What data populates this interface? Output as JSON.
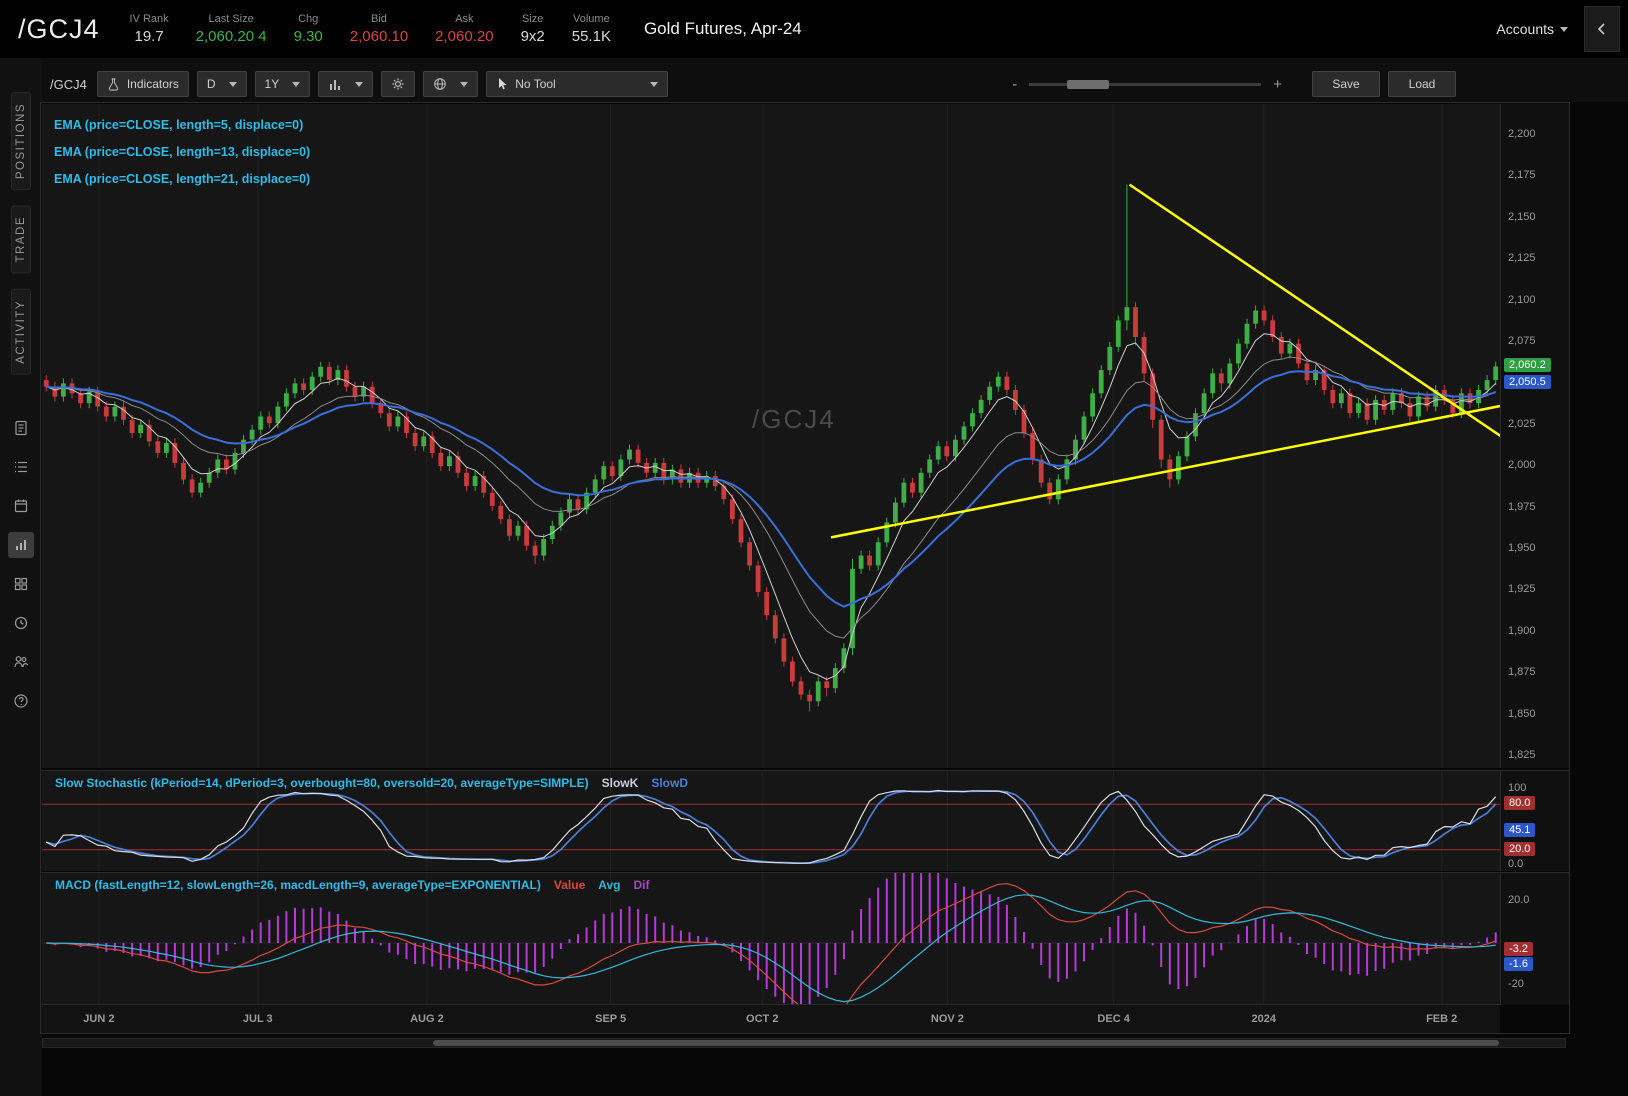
{
  "header": {
    "symbol": "/GCJ4",
    "title": "Gold Futures, Apr-24",
    "accounts_label": "Accounts",
    "stats": [
      {
        "label": "IV Rank",
        "value": "19.7",
        "color": "#d8d8d8"
      },
      {
        "label": "Last Size",
        "value": "2,060.20 4",
        "color": "#3cb54b"
      },
      {
        "label": "Chg",
        "value": "9.30",
        "color": "#3cb54b"
      },
      {
        "label": "Bid",
        "value": "2,060.10",
        "color": "#d64a3f"
      },
      {
        "label": "Ask",
        "value": "2,060.20",
        "color": "#d64a3f"
      },
      {
        "label": "Size",
        "value": "9x2",
        "color": "#d8d8d8"
      },
      {
        "label": "Volume",
        "value": "55.1K",
        "color": "#d8d8d8"
      }
    ]
  },
  "sidebar": {
    "tabs": [
      {
        "label": "POSITIONS"
      },
      {
        "label": "TRADE"
      },
      {
        "label": "ACTIVITY"
      }
    ]
  },
  "toolbar": {
    "symbol": "/GCJ4",
    "indicators_label": "Indicators",
    "timeframe": "D",
    "range": "1Y",
    "tool_label": "No Tool",
    "zoom_minus": "-",
    "zoom_plus": "+",
    "save_label": "Save",
    "load_label": "Load"
  },
  "chart": {
    "watermark": "/GCJ4",
    "ema_labels": [
      "EMA (price=CLOSE, length=5, displace=0)",
      "EMA (price=CLOSE, length=13, displace=0)",
      "EMA (price=CLOSE, length=21, displace=0)"
    ]
  },
  "stoch": {
    "title": "Slow Stochastic (kPeriod=14, dPeriod=3, overbought=80, oversold=20, averageType=SIMPLE)",
    "legend": [
      {
        "label": "SlowK",
        "color": "#c9ced8"
      },
      {
        "label": "SlowD",
        "color": "#4a7fd8"
      }
    ]
  },
  "macd": {
    "title": "MACD (fastLength=12, slowLength=26, macdLength=9, averageType=EXPONENTIAL)",
    "legend": [
      {
        "label": "Value",
        "color": "#d64a3f"
      },
      {
        "label": "Avg",
        "color": "#35b8d8"
      },
      {
        "label": "Dif",
        "color": "#b03fd0"
      }
    ]
  },
  "chart_data": {
    "type": "candlestick",
    "symbol": "/GCJ4",
    "title": "Gold Futures, Apr-24, Daily, 1 Year",
    "last_price": 2060.2,
    "colors": {
      "up": "#3fae49",
      "down": "#c83c3c",
      "ema5": "#cfcfcf",
      "ema13": "#8a8a8a",
      "ema21": "#3a6fd8",
      "trendline": "#ffff00",
      "grid": "#212121",
      "slowk": "#d8dee8",
      "slowd": "#4a7fd8",
      "ob_os_line": "#a03030",
      "macd_value": "#d64a3f",
      "macd_avg": "#35b8d8",
      "macd_hist": "#b43bd8"
    },
    "price_axis": {
      "ticks": [
        {
          "label": "2,200",
          "value": 2200
        },
        {
          "label": "2,175",
          "value": 2175
        },
        {
          "label": "2,150",
          "value": 2150
        },
        {
          "label": "2,125",
          "value": 2125
        },
        {
          "label": "2,100",
          "value": 2100
        },
        {
          "label": "2,075",
          "value": 2075
        },
        {
          "label": "2,050",
          "value": 2050
        },
        {
          "label": "2,025",
          "value": 2025
        },
        {
          "label": "2,000",
          "value": 2000
        },
        {
          "label": "1,975",
          "value": 1975
        },
        {
          "label": "1,950",
          "value": 1950
        },
        {
          "label": "1,925",
          "value": 1925
        },
        {
          "label": "1,900",
          "value": 1900
        },
        {
          "label": "1,875",
          "value": 1875
        },
        {
          "label": "1,850",
          "value": 1850
        },
        {
          "label": "1,825",
          "value": 1825
        }
      ],
      "badges": [
        {
          "label": "2,060.2",
          "value": 2060.2,
          "bg": "#2f9e44"
        },
        {
          "label": "2,050.5",
          "value": 2050.5,
          "bg": "#2b57c8"
        }
      ]
    },
    "stoch_axis": {
      "labels": [
        {
          "label": "100",
          "value": 100
        },
        {
          "label": "0.0",
          "value": 0
        }
      ],
      "badges": [
        {
          "label": "80.0",
          "value": 80,
          "bg": "#a03030"
        },
        {
          "label": "45.1",
          "value": 45.1,
          "bg": "#2b57c8"
        },
        {
          "label": "20.0",
          "value": 20,
          "bg": "#a03030"
        }
      ]
    },
    "macd_axis": {
      "labels": [
        {
          "label": "20.0",
          "value": 20
        },
        {
          "label": "-20",
          "value": -20
        }
      ],
      "badges": [
        {
          "label": "-3.2",
          "value": -3.2,
          "bg": "#a03030"
        },
        {
          "label": "-1.6",
          "value": -1.6,
          "bg": "#2b57c8"
        }
      ]
    },
    "time_axis": [
      {
        "label": "JUN 2",
        "frac": 0.039
      },
      {
        "label": "JUL 3",
        "frac": 0.148
      },
      {
        "label": "AUG 2",
        "frac": 0.264
      },
      {
        "label": "SEP 5",
        "frac": 0.39
      },
      {
        "label": "OCT 2",
        "frac": 0.494
      },
      {
        "label": "NOV 2",
        "frac": 0.621
      },
      {
        "label": "DEC 4",
        "frac": 0.735
      },
      {
        "label": "2024",
        "frac": 0.838
      },
      {
        "label": "FEB 2",
        "frac": 0.96
      }
    ],
    "trendlines": [
      {
        "i1": 126.3,
        "p1": 2170,
        "i2": 170.2,
        "p2": 2016
      },
      {
        "i1": 91.5,
        "p1": 1957,
        "i2": 170.2,
        "p2": 2037
      }
    ],
    "candles": [
      [
        2052,
        2055,
        2045,
        2048
      ],
      [
        2048,
        2051,
        2039,
        2042
      ],
      [
        2042,
        2053,
        2039,
        2050
      ],
      [
        2050,
        2053,
        2041,
        2044
      ],
      [
        2044,
        2047,
        2035,
        2038
      ],
      [
        2038,
        2048,
        2035,
        2045
      ],
      [
        2045,
        2048,
        2033,
        2036
      ],
      [
        2036,
        2039,
        2027,
        2030
      ],
      [
        2030,
        2039,
        2027,
        2036
      ],
      [
        2036,
        2039,
        2025,
        2028
      ],
      [
        2028,
        2031,
        2017,
        2020
      ],
      [
        2020,
        2028,
        2017,
        2025
      ],
      [
        2025,
        2028,
        2012,
        2015
      ],
      [
        2015,
        2018,
        2005,
        2008
      ],
      [
        2008,
        2017,
        2005,
        2014
      ],
      [
        2014,
        2017,
        1999,
        2002
      ],
      [
        2002,
        2005,
        1989,
        1992
      ],
      [
        1992,
        1995,
        1981,
        1984
      ],
      [
        1984,
        1993,
        1981,
        1990
      ],
      [
        1990,
        1999,
        1987,
        1996
      ],
      [
        1996,
        2007,
        1993,
        2004
      ],
      [
        2004,
        2007,
        1995,
        1998
      ],
      [
        1998,
        2011,
        1995,
        2008
      ],
      [
        2008,
        2019,
        2005,
        2016
      ],
      [
        2016,
        2025,
        2013,
        2022
      ],
      [
        2022,
        2033,
        2019,
        2030
      ],
      [
        2030,
        2033,
        2023,
        2026
      ],
      [
        2026,
        2039,
        2023,
        2036
      ],
      [
        2036,
        2047,
        2033,
        2044
      ],
      [
        2044,
        2053,
        2041,
        2050
      ],
      [
        2050,
        2053,
        2043,
        2046
      ],
      [
        2046,
        2057,
        2043,
        2054
      ],
      [
        2054,
        2063,
        2051,
        2060
      ],
      [
        2060,
        2063,
        2049,
        2052
      ],
      [
        2052,
        2061,
        2049,
        2058
      ],
      [
        2058,
        2061,
        2045,
        2048
      ],
      [
        2048,
        2051,
        2039,
        2042
      ],
      [
        2042,
        2051,
        2039,
        2048
      ],
      [
        2048,
        2051,
        2035,
        2038
      ],
      [
        2038,
        2041,
        2029,
        2032
      ],
      [
        2032,
        2035,
        2021,
        2024
      ],
      [
        2024,
        2033,
        2021,
        2030
      ],
      [
        2030,
        2033,
        2017,
        2020
      ],
      [
        2020,
        2023,
        2009,
        2012
      ],
      [
        2012,
        2021,
        2009,
        2018
      ],
      [
        2018,
        2021,
        2005,
        2008
      ],
      [
        2008,
        2011,
        1997,
        2000
      ],
      [
        2000,
        2009,
        1997,
        2006
      ],
      [
        2006,
        2009,
        1993,
        1996
      ],
      [
        1996,
        1999,
        1985,
        1988
      ],
      [
        1988,
        1997,
        1985,
        1994
      ],
      [
        1994,
        1997,
        1981,
        1984
      ],
      [
        1984,
        1987,
        1973,
        1976
      ],
      [
        1976,
        1979,
        1965,
        1968
      ],
      [
        1968,
        1971,
        1955,
        1958
      ],
      [
        1958,
        1967,
        1955,
        1964
      ],
      [
        1964,
        1967,
        1949,
        1952
      ],
      [
        1952,
        1955,
        1941,
        1946
      ],
      [
        1946,
        1959,
        1943,
        1956
      ],
      [
        1956,
        1967,
        1953,
        1964
      ],
      [
        1964,
        1975,
        1961,
        1972
      ],
      [
        1972,
        1983,
        1969,
        1980
      ],
      [
        1980,
        1983,
        1971,
        1974
      ],
      [
        1974,
        1987,
        1971,
        1984
      ],
      [
        1984,
        1995,
        1981,
        1992
      ],
      [
        1992,
        2003,
        1989,
        2000
      ],
      [
        2000,
        2003,
        1991,
        1994
      ],
      [
        1994,
        2007,
        1991,
        2004
      ],
      [
        2004,
        2013,
        2001,
        2010
      ],
      [
        2010,
        2013,
        1999,
        2002
      ],
      [
        2002,
        2005,
        1993,
        1996
      ],
      [
        1996,
        2005,
        1993,
        2002
      ],
      [
        2002,
        2005,
        1989,
        1992
      ],
      [
        1992,
        2001,
        1989,
        1998
      ],
      [
        1998,
        2001,
        1987,
        1990
      ],
      [
        1990,
        1999,
        1987,
        1996
      ],
      [
        1996,
        1999,
        1987,
        1990
      ],
      [
        1990,
        1997,
        1987,
        1994
      ],
      [
        1994,
        1997,
        1985,
        1988
      ],
      [
        1988,
        1991,
        1977,
        1980
      ],
      [
        1980,
        1983,
        1965,
        1968
      ],
      [
        1968,
        1971,
        1951,
        1954
      ],
      [
        1954,
        1957,
        1937,
        1940
      ],
      [
        1940,
        1943,
        1921,
        1924
      ],
      [
        1924,
        1927,
        1907,
        1910
      ],
      [
        1910,
        1913,
        1893,
        1896
      ],
      [
        1896,
        1899,
        1879,
        1882
      ],
      [
        1882,
        1885,
        1867,
        1870
      ],
      [
        1870,
        1873,
        1859,
        1862
      ],
      [
        1862,
        1865,
        1852,
        1858
      ],
      [
        1858,
        1873,
        1855,
        1870
      ],
      [
        1870,
        1873,
        1861,
        1866
      ],
      [
        1866,
        1881,
        1863,
        1878
      ],
      [
        1878,
        1893,
        1875,
        1890
      ],
      [
        1890,
        1944,
        1886,
        1938
      ],
      [
        1938,
        1949,
        1935,
        1946
      ],
      [
        1946,
        1949,
        1937,
        1940
      ],
      [
        1940,
        1957,
        1937,
        1954
      ],
      [
        1954,
        1969,
        1951,
        1966
      ],
      [
        1966,
        1981,
        1963,
        1978
      ],
      [
        1978,
        1993,
        1975,
        1990
      ],
      [
        1990,
        1993,
        1981,
        1984
      ],
      [
        1984,
        1999,
        1981,
        1996
      ],
      [
        1996,
        2007,
        1993,
        2004
      ],
      [
        2004,
        2015,
        2001,
        2012
      ],
      [
        2012,
        2015,
        2003,
        2006
      ],
      [
        2006,
        2019,
        2003,
        2016
      ],
      [
        2016,
        2027,
        2013,
        2024
      ],
      [
        2024,
        2035,
        2021,
        2032
      ],
      [
        2032,
        2043,
        2029,
        2040
      ],
      [
        2040,
        2051,
        2037,
        2048
      ],
      [
        2048,
        2057,
        2045,
        2054
      ],
      [
        2054,
        2057,
        2043,
        2046
      ],
      [
        2046,
        2049,
        2031,
        2034
      ],
      [
        2034,
        2037,
        2017,
        2020
      ],
      [
        2020,
        2023,
        2001,
        2004
      ],
      [
        2004,
        2007,
        1987,
        1990
      ],
      [
        1990,
        1993,
        1977,
        1980
      ],
      [
        1980,
        1995,
        1977,
        1992
      ],
      [
        1992,
        2007,
        1989,
        2004
      ],
      [
        2004,
        2019,
        2001,
        2016
      ],
      [
        2016,
        2033,
        2013,
        2030
      ],
      [
        2030,
        2047,
        2027,
        2044
      ],
      [
        2044,
        2061,
        2041,
        2058
      ],
      [
        2058,
        2075,
        2055,
        2072
      ],
      [
        2072,
        2091,
        2069,
        2088
      ],
      [
        2088,
        2170,
        2082,
        2096
      ],
      [
        2096,
        2099,
        2073,
        2078
      ],
      [
        2078,
        2081,
        2051,
        2056
      ],
      [
        2056,
        2059,
        2023,
        2028
      ],
      [
        2028,
        2031,
        1999,
        2004
      ],
      [
        2004,
        2007,
        1987,
        1992
      ],
      [
        1992,
        2009,
        1989,
        2006
      ],
      [
        2006,
        2021,
        2003,
        2018
      ],
      [
        2018,
        2035,
        2015,
        2032
      ],
      [
        2032,
        2047,
        2029,
        2044
      ],
      [
        2044,
        2059,
        2041,
        2056
      ],
      [
        2056,
        2059,
        2045,
        2050
      ],
      [
        2050,
        2065,
        2047,
        2062
      ],
      [
        2062,
        2077,
        2059,
        2074
      ],
      [
        2074,
        2089,
        2071,
        2086
      ],
      [
        2086,
        2097,
        2083,
        2094
      ],
      [
        2094,
        2097,
        2085,
        2088
      ],
      [
        2088,
        2091,
        2075,
        2078
      ],
      [
        2078,
        2081,
        2065,
        2068
      ],
      [
        2068,
        2077,
        2065,
        2074
      ],
      [
        2074,
        2077,
        2059,
        2062
      ],
      [
        2062,
        2065,
        2049,
        2052
      ],
      [
        2052,
        2061,
        2049,
        2058
      ],
      [
        2058,
        2061,
        2043,
        2046
      ],
      [
        2046,
        2049,
        2035,
        2038
      ],
      [
        2038,
        2047,
        2035,
        2044
      ],
      [
        2044,
        2047,
        2029,
        2032
      ],
      [
        2032,
        2041,
        2029,
        2038
      ],
      [
        2038,
        2041,
        2025,
        2028
      ],
      [
        2028,
        2043,
        2025,
        2040
      ],
      [
        2040,
        2043,
        2031,
        2034
      ],
      [
        2034,
        2047,
        2031,
        2044
      ],
      [
        2044,
        2047,
        2035,
        2038
      ],
      [
        2038,
        2041,
        2027,
        2030
      ],
      [
        2030,
        2045,
        2027,
        2042
      ],
      [
        2042,
        2045,
        2033,
        2036
      ],
      [
        2036,
        2049,
        2033,
        2046
      ],
      [
        2046,
        2049,
        2037,
        2040
      ],
      [
        2040,
        2043,
        2029,
        2032
      ],
      [
        2032,
        2047,
        2029,
        2044
      ],
      [
        2044,
        2047,
        2035,
        2038
      ],
      [
        2038,
        2049,
        2035,
        2046
      ],
      [
        2046,
        2055,
        2043,
        2052
      ],
      [
        2052,
        2063,
        2049,
        2060.2
      ]
    ]
  }
}
